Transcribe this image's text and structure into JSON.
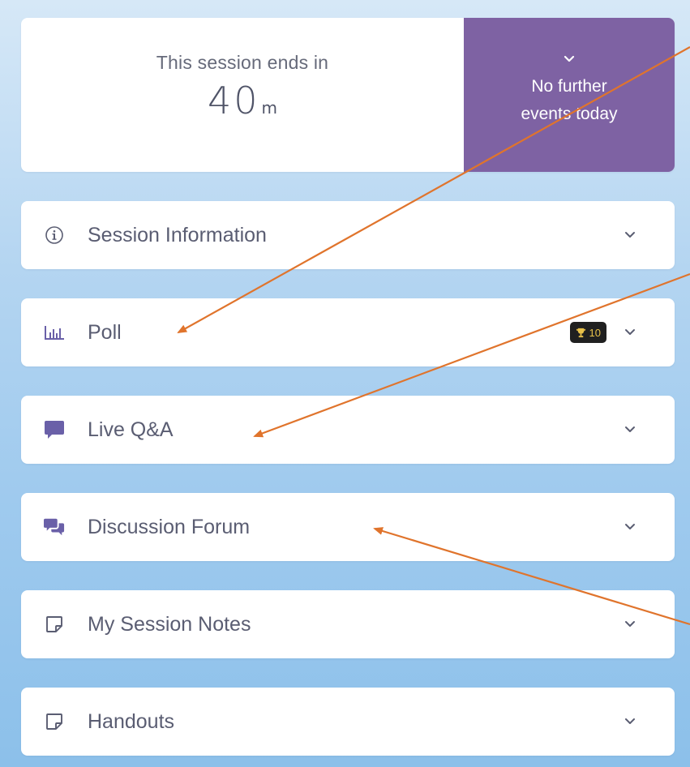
{
  "timer": {
    "caption": "This session ends in",
    "value": "40",
    "unit": "m"
  },
  "next_events": {
    "line1": "No further",
    "line2": "events today"
  },
  "sections": [
    {
      "label": "Session Information",
      "icon": "info-icon"
    },
    {
      "label": "Poll",
      "icon": "bar-chart-icon",
      "badge": {
        "icon": "trophy-icon",
        "value": "10"
      }
    },
    {
      "label": "Live Q&A",
      "icon": "chat-bubble-icon"
    },
    {
      "label": "Discussion Forum",
      "icon": "chat-bubbles-icon"
    },
    {
      "label": "My Session Notes",
      "icon": "note-icon"
    },
    {
      "label": "Handouts",
      "icon": "note-icon"
    }
  ],
  "colors": {
    "accent_purple": "#7e62a3",
    "annotation_arrow": "#e0742c",
    "badge_background": "#202020",
    "badge_text": "#e8c14a"
  }
}
